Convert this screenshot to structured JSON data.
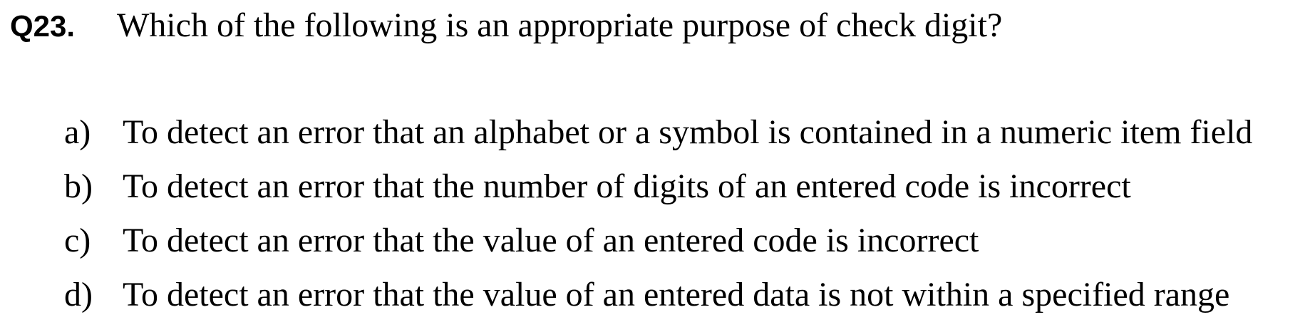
{
  "question": {
    "number": "Q23.",
    "text": "Which of the following is an appropriate purpose of check digit?"
  },
  "options": [
    {
      "letter": "a)",
      "text": "To detect an error that an alphabet or a symbol is contained in a numeric item field"
    },
    {
      "letter": "b)",
      "text": "To detect an error that the number of digits of an entered code is incorrect"
    },
    {
      "letter": "c)",
      "text": "To detect an error that the value of an entered code is incorrect"
    },
    {
      "letter": "d)",
      "text": "To detect an error that the value of an entered data is not within a specified range"
    }
  ]
}
